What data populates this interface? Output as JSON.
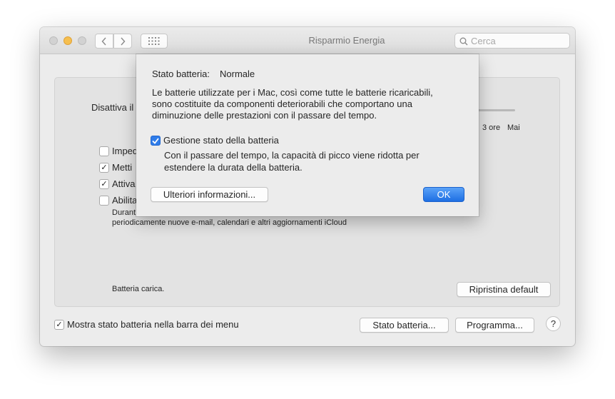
{
  "window": {
    "title": "Risparmio Energia",
    "search_placeholder": "Cerca"
  },
  "panel": {
    "sleep_label_partial": "Disattiva il",
    "slider_labels": [
      "3 ore",
      "Mai"
    ],
    "options": [
      {
        "label_partial": "Imped",
        "checked": false
      },
      {
        "label_partial": "Metti",
        "checked": true
      },
      {
        "label_partial": "Attiva",
        "checked": true
      },
      {
        "label_partial": "Abilita",
        "checked": false
      }
    ],
    "option_desc_partial": "Durant",
    "option_desc_line2": "periodicamente nuove e-mail, calendari e altri aggiornamenti iCloud",
    "battery_status": "Batteria carica.",
    "restore_default_button": "Ripristina default"
  },
  "footer": {
    "show_status_checkbox_label": "Mostra stato batteria nella barra dei menu",
    "show_status_checked": true,
    "battery_status_button": "Stato batteria...",
    "schedule_button": "Programma...",
    "help_button": "?"
  },
  "sheet": {
    "status_label": "Stato batteria:",
    "status_value": "Normale",
    "description": [
      "Le batterie utilizzate per i Mac, così come tutte le batterie ricaricabili,",
      "sono costituite da componenti deteriorabili che comportano una",
      "diminuzione delle prestazioni con il passare del tempo."
    ],
    "management_checkbox_label": "Gestione stato della batteria",
    "management_checked": true,
    "management_desc": [
      "Con il passare del tempo, la capacità di picco viene ridotta per",
      "estendere la durata della batteria."
    ],
    "more_info_button": "Ulteriori informazioni...",
    "ok_button": "OK"
  },
  "colors": {
    "accent": "#2f7ce9",
    "window_bg": "#ececec",
    "panel_bg": "#e3e3e3"
  }
}
